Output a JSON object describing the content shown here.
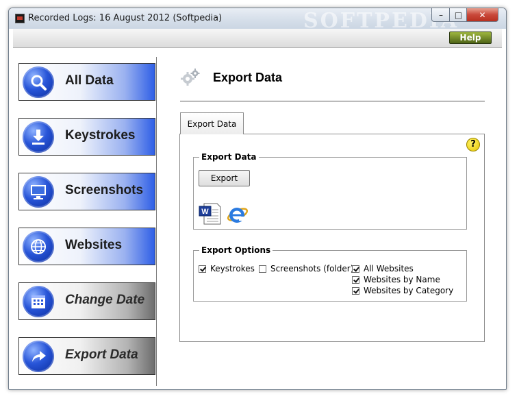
{
  "window": {
    "title": "Recorded Logs: 16 August 2012  (Softpedia)",
    "watermark": "SOFTPEDIA"
  },
  "toolbar": {
    "help_label": "Help"
  },
  "sidebar": {
    "items": [
      {
        "label": "All Data",
        "icon": "magnifier-icon",
        "style": "blue"
      },
      {
        "label": "Keystrokes",
        "icon": "download-icon",
        "style": "blue"
      },
      {
        "label": "Screenshots",
        "icon": "monitor-icon",
        "style": "blue"
      },
      {
        "label": "Websites",
        "icon": "globe-icon",
        "style": "blue"
      },
      {
        "label": "Change Date",
        "icon": "calendar-icon",
        "style": "gray"
      },
      {
        "label": "Export Data",
        "icon": "share-arrow-icon",
        "style": "gray"
      }
    ]
  },
  "main": {
    "page_title": "Export Data",
    "tab_label": "Export Data",
    "export_group": {
      "title": "Export Data",
      "button_label": "Export",
      "formats": [
        "word-doc-icon",
        "internet-explorer-icon"
      ]
    },
    "options_group": {
      "title": "Export Options",
      "options": [
        {
          "label": "Keystrokes",
          "checked": true
        },
        {
          "label": "Screenshots (folder)",
          "checked": false
        },
        {
          "label": "All Websites",
          "checked": true
        },
        {
          "label": "Websites by Name",
          "checked": true
        },
        {
          "label": "Websites by Category",
          "checked": true
        }
      ]
    }
  },
  "colors": {
    "nav_blue": "#2f5fe6",
    "nav_gray": "#6d6d6d",
    "help_green": "#4f6417",
    "close_red": "#c9483a"
  }
}
